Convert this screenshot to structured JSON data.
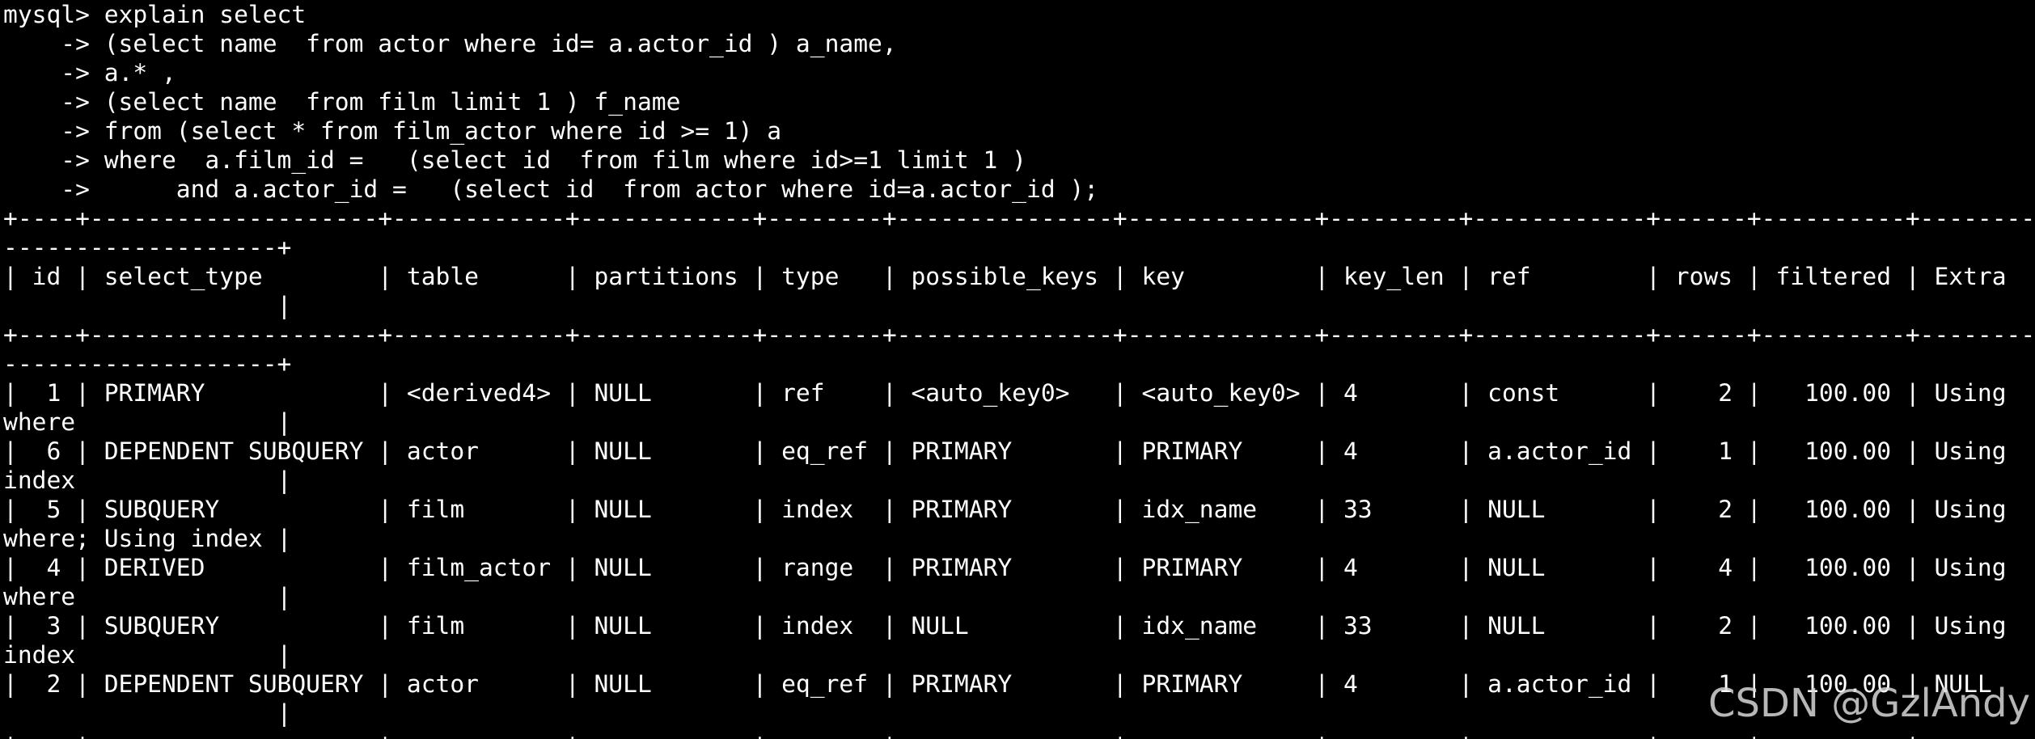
{
  "terminal": {
    "lines": [
      "mysql> explain select",
      "    -> (select name  from actor where id= a.actor_id ) a_name,",
      "    -> a.* ,",
      "    -> (select name  from film limit 1 ) f_name",
      "    -> from (select * from film_actor where id >= 1) a",
      "    -> where  a.film_id =   (select id  from film where id>=1 limit 1 )",
      "    ->      and a.actor_id =   (select id  from actor where id=a.actor_id );",
      "+----+--------------------+------------+------------+--------+---------------+-------------+---------+------------+------+----------+-----------",
      "-------------------+",
      "| id | select_type        | table      | partitions | type   | possible_keys | key         | key_len | ref        | rows | filtered | Extra",
      "                   |",
      "+----+--------------------+------------+------------+--------+---------------+-------------+---------+------------+------+----------+-----------",
      "-------------------+",
      "|  1 | PRIMARY            | <derived4> | NULL       | ref    | <auto_key0>   | <auto_key0> | 4       | const      |    2 |   100.00 | Using",
      "where              |",
      "|  6 | DEPENDENT SUBQUERY | actor      | NULL       | eq_ref | PRIMARY       | PRIMARY     | 4       | a.actor_id |    1 |   100.00 | Using",
      "index              |",
      "|  5 | SUBQUERY           | film       | NULL       | index  | PRIMARY       | idx_name    | 33      | NULL       |    2 |   100.00 | Using",
      "where; Using index |",
      "|  4 | DERIVED            | film_actor | NULL       | range  | PRIMARY       | PRIMARY     | 4       | NULL       |    4 |   100.00 | Using",
      "where              |",
      "|  3 | SUBQUERY           | film       | NULL       | index  | NULL          | idx_name    | 33      | NULL       |    2 |   100.00 | Using",
      "index              |",
      "|  2 | DEPENDENT SUBQUERY | actor      | NULL       | eq_ref | PRIMARY       | PRIMARY     | 4       | a.actor_id |    1 |   100.00 | NULL",
      "                   |",
      "+----+--------------------+------------+------------+--------+---------------+-------------+---------+------------+------+----------+-----------"
    ]
  },
  "watermark": {
    "text": "CSDN @GzlAndy"
  }
}
